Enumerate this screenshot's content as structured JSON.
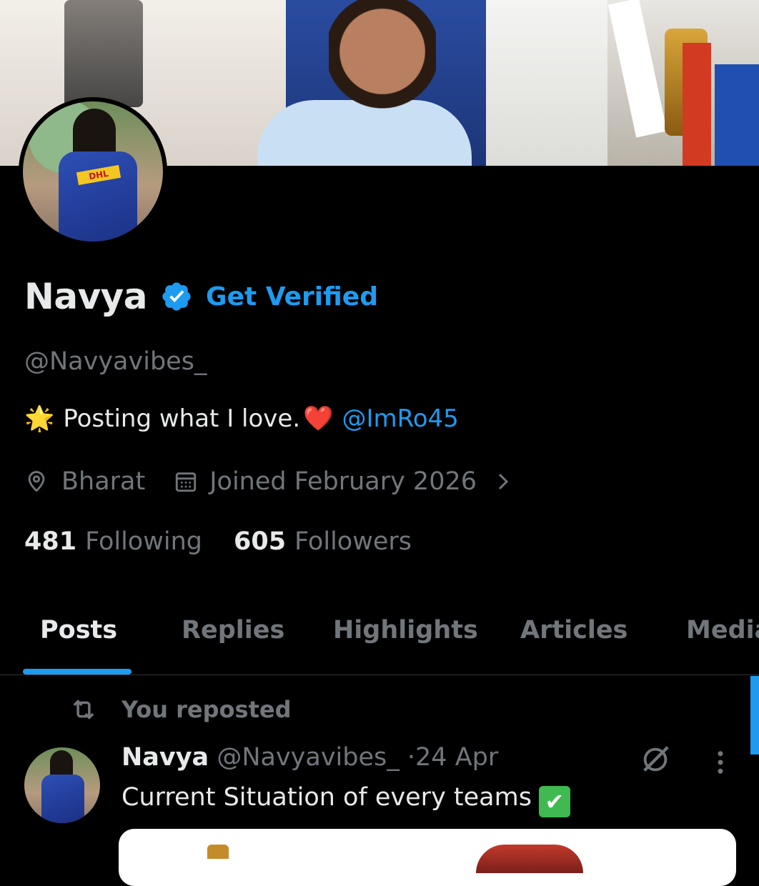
{
  "profile": {
    "name": "Navya",
    "get_verified_label": "Get Verified",
    "handle": "@Navyavibes_",
    "bio": {
      "star": "🌟",
      "text": "Posting what I love.",
      "heart": "❤️",
      "mention": "@ImRo45"
    },
    "location": "Bharat",
    "joined": "Joined February 2026"
  },
  "stats": {
    "following_count": "481",
    "following_label": "Following",
    "followers_count": "605",
    "followers_label": "Followers"
  },
  "tabs": [
    {
      "label": "Posts",
      "active": true
    },
    {
      "label": "Replies",
      "active": false
    },
    {
      "label": "Highlights",
      "active": false
    },
    {
      "label": "Articles",
      "active": false
    },
    {
      "label": "Media",
      "active": false
    }
  ],
  "feed": {
    "repost_label": "You reposted",
    "post": {
      "author_name": "Navya",
      "author_handle": "@Navyavibes_",
      "separator": "·",
      "date": "24 Apr",
      "text": "Current Situation of every teams",
      "check_emoji": "✔"
    }
  },
  "colors": {
    "accent": "#1d9bf0",
    "background": "#000000",
    "muted_text": "#71767b",
    "primary_text": "#e7e9ea"
  },
  "icons": [
    "verified-badge-icon",
    "location-pin-icon",
    "calendar-icon",
    "chevron-right-icon",
    "repost-icon",
    "grok-icon",
    "more-vertical-icon"
  ]
}
